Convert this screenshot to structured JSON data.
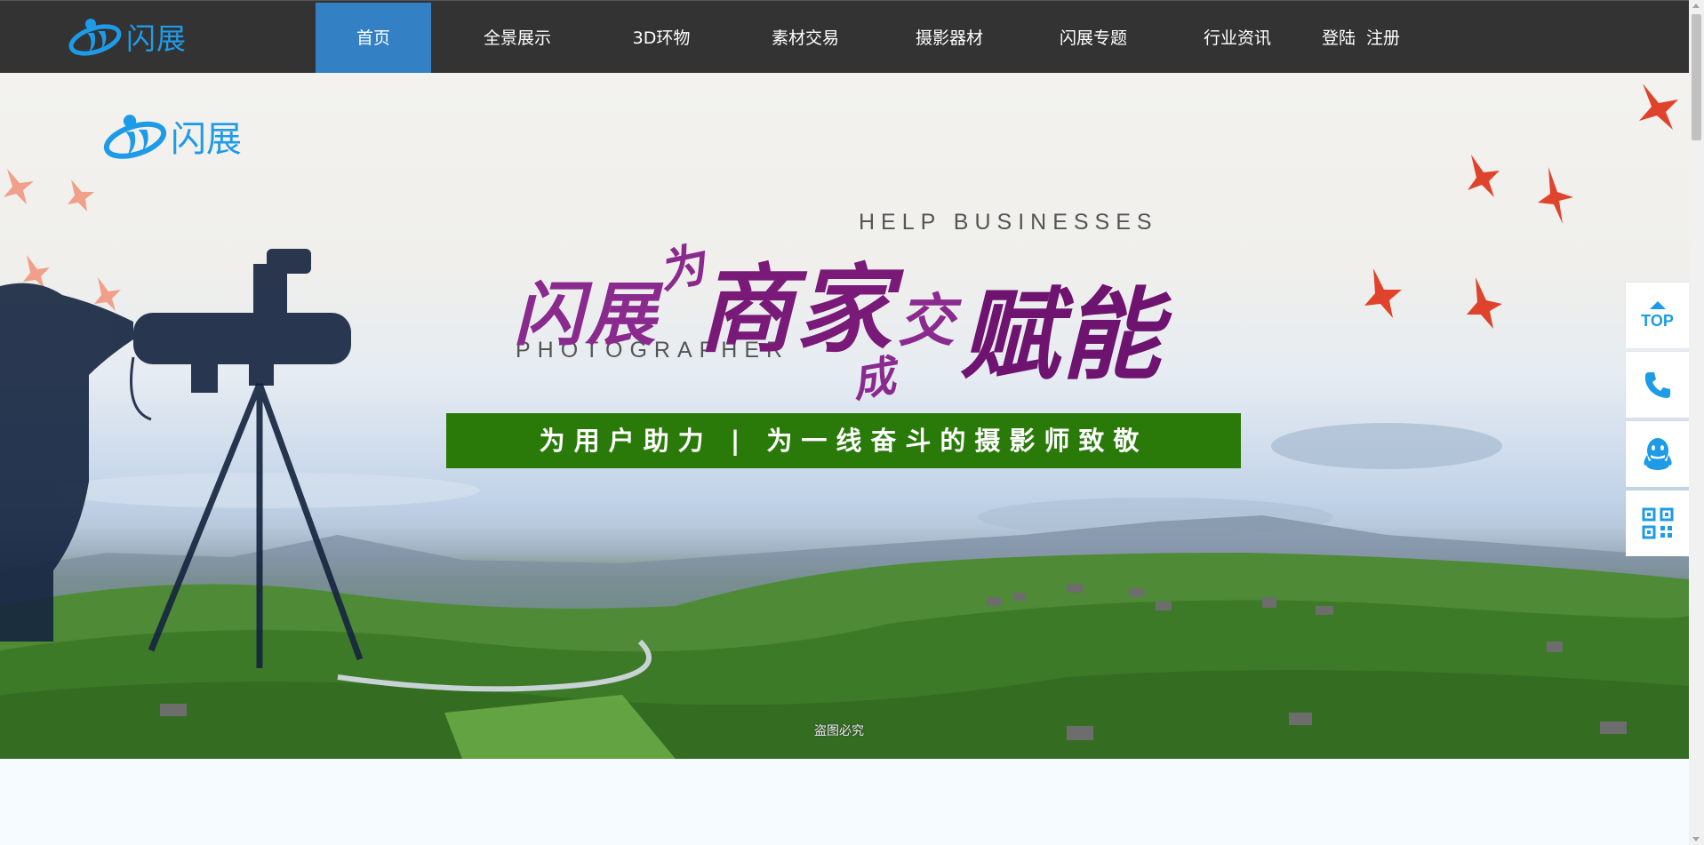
{
  "brand": {
    "name": "闪展"
  },
  "nav": {
    "items": [
      {
        "label": "首页",
        "active": true
      },
      {
        "label": "全景展示",
        "active": false
      },
      {
        "label": "3D环物",
        "active": false
      },
      {
        "label": "素材交易",
        "active": false
      },
      {
        "label": "摄影器材",
        "active": false
      },
      {
        "label": "闪展专题",
        "active": false
      },
      {
        "label": "行业资讯",
        "active": false
      }
    ],
    "login_label": "登陆",
    "register_label": "注册"
  },
  "banner": {
    "logo_text": "闪展",
    "en_line_1": "HELP BUSINESSES",
    "en_line_2": "PHOTOGRAPHER",
    "headline": {
      "part1": "闪展",
      "part2": "为",
      "part3": "商家",
      "part4": "成",
      "part5": "交",
      "part6": "赋能"
    },
    "slogan": "为用户助力 | 为一线奋斗的摄影师致敬",
    "watermark": "盗图必究"
  },
  "sidebar": {
    "top_label": "TOP",
    "buttons": [
      "top-icon",
      "phone-icon",
      "qq-icon",
      "qrcode-icon"
    ]
  },
  "colors": {
    "nav_bg": "#333333",
    "nav_active": "#3380c4",
    "brand_blue": "#1e9be8",
    "slogan_bg": "#2a7a0a",
    "headline_purple": "#7a1a78"
  }
}
